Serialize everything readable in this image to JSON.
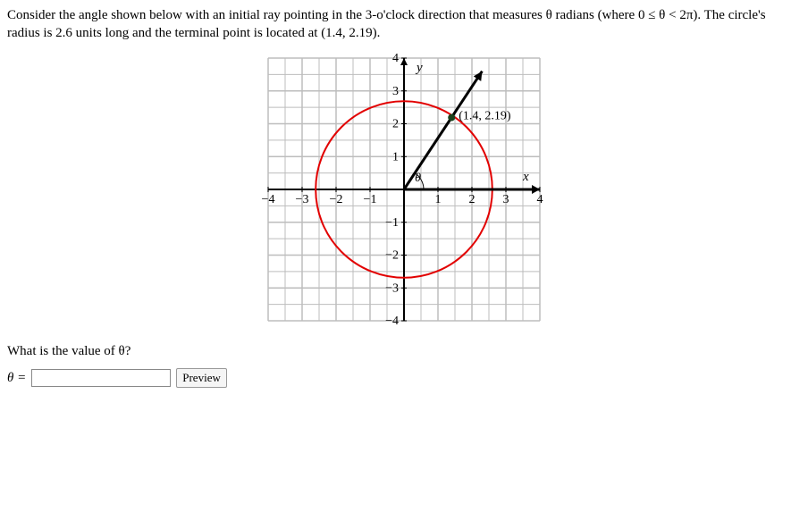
{
  "problem": {
    "line1": "Consider the angle shown below with an initial ray pointing in the 3-o'clock direction that measures θ radians (where 0 ≤ θ < 2π). The circle's",
    "line2": "radius is 2.6 units long and the terminal point is located at (1.4, 2.19)."
  },
  "question": "What is the value of θ?",
  "answer": {
    "lhs": "θ =",
    "value": "",
    "preview_label": "Preview"
  },
  "chart_data": {
    "type": "diagram",
    "xrange": [
      -4,
      4
    ],
    "yrange": [
      -4,
      4
    ],
    "circle": {
      "cx": 0,
      "cy": 0,
      "r": 2.6
    },
    "terminal_point": {
      "x": 1.4,
      "y": 2.19,
      "label": "(1.4, 2.19)"
    },
    "initial_ray_to": {
      "x": 4,
      "y": 0
    },
    "terminal_ray_to": {
      "x": 2.3,
      "y": 3.6
    },
    "axis_labels": {
      "x": "x",
      "y": "y"
    },
    "theta_symbol": "θ",
    "x_ticks": [
      -4,
      -3,
      -2,
      -1,
      1,
      2,
      3,
      4
    ],
    "y_ticks": [
      -4,
      -3,
      -2,
      -1,
      1,
      2,
      3,
      4
    ]
  }
}
